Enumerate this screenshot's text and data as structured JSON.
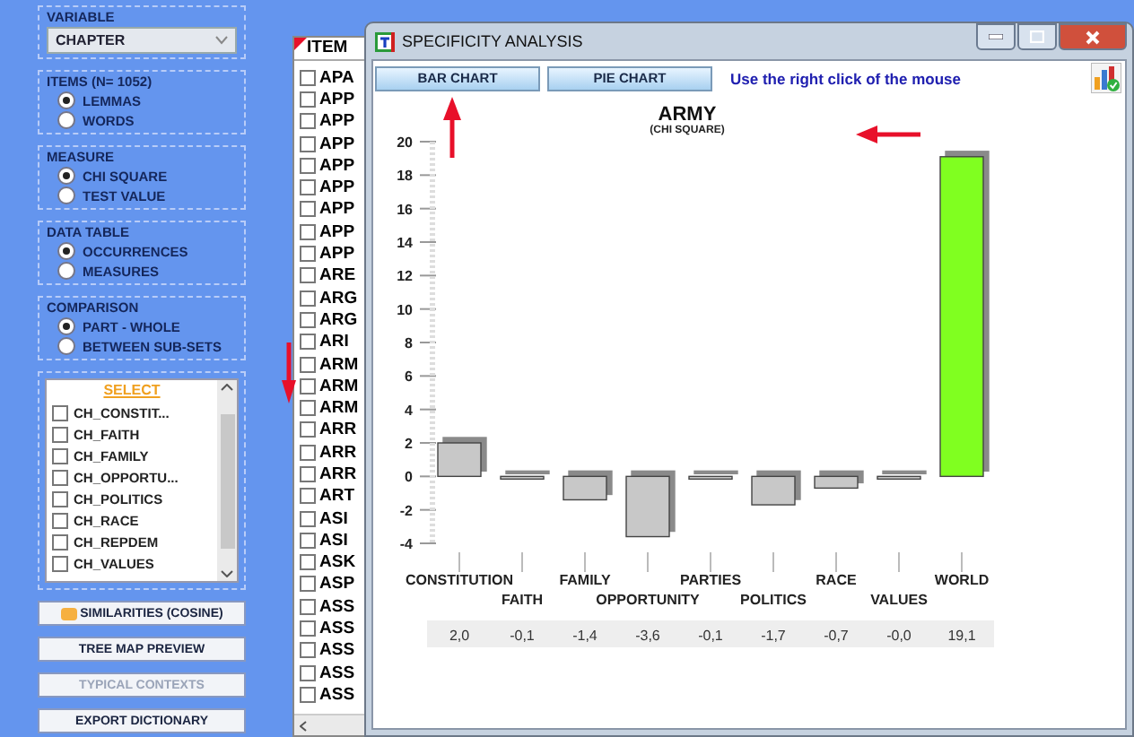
{
  "left_panel": {
    "variable": {
      "label": "VARIABLE",
      "value": "CHAPTER"
    },
    "groups": [
      {
        "title": "ITEMS (N= 1052)",
        "options": [
          {
            "label": "LEMMAS",
            "selected": true
          },
          {
            "label": "WORDS",
            "selected": false
          }
        ]
      },
      {
        "title": "MEASURE",
        "options": [
          {
            "label": "CHI SQUARE",
            "selected": true
          },
          {
            "label": "TEST VALUE",
            "selected": false
          }
        ]
      },
      {
        "title": "DATA TABLE",
        "options": [
          {
            "label": "OCCURRENCES",
            "selected": true
          },
          {
            "label": "MEASURES",
            "selected": false
          }
        ]
      },
      {
        "title": "COMPARISON",
        "options": [
          {
            "label": "PART - WHOLE",
            "selected": true
          },
          {
            "label": "BETWEEN SUB-SETS",
            "selected": false
          }
        ]
      }
    ],
    "select_list": {
      "header": "SELECT",
      "items": [
        {
          "label": "CH_CONSTIT...",
          "checked": false
        },
        {
          "label": "CH_FAITH",
          "checked": false
        },
        {
          "label": "CH_FAMILY",
          "checked": false
        },
        {
          "label": "CH_OPPORTU...",
          "checked": false
        },
        {
          "label": "CH_POLITICS",
          "checked": false
        },
        {
          "label": "CH_RACE",
          "checked": false
        },
        {
          "label": "CH_REPDEM",
          "checked": false
        },
        {
          "label": "CH_VALUES",
          "checked": false
        }
      ]
    },
    "buttons": [
      {
        "label": "SIMILARITIES (COSINE)",
        "kind": "icon",
        "disabled": false
      },
      {
        "label": "TREE MAP PREVIEW",
        "kind": "plain",
        "disabled": false
      },
      {
        "label": "TYPICAL CONTEXTS",
        "kind": "plain",
        "disabled": true
      },
      {
        "label": "EXPORT DICTIONARY",
        "kind": "plain",
        "disabled": false
      }
    ]
  },
  "item_list": {
    "header": "ITEM",
    "rows": [
      {
        "label": "APA",
        "checked": false
      },
      {
        "label": "APP",
        "checked": false
      },
      {
        "label": "APP",
        "checked": false
      },
      {
        "label": "APP",
        "checked": false
      },
      {
        "label": "APP",
        "checked": false
      },
      {
        "label": "APP",
        "checked": false
      },
      {
        "label": "APP",
        "checked": false
      },
      {
        "label": "APP",
        "checked": false
      },
      {
        "label": "APP",
        "checked": false
      },
      {
        "label": "ARE",
        "checked": false
      },
      {
        "label": "ARG",
        "checked": false
      },
      {
        "label": "ARG",
        "checked": false
      },
      {
        "label": "ARI",
        "checked": false
      },
      {
        "label": "ARM",
        "checked": false
      },
      {
        "label": "ARM",
        "checked": false
      },
      {
        "label": "ARM",
        "checked": false,
        "pointer_arrow": true
      },
      {
        "label": "ARR",
        "checked": false
      },
      {
        "label": "ARR",
        "checked": false
      },
      {
        "label": "ARR",
        "checked": false
      },
      {
        "label": "ART",
        "checked": false
      },
      {
        "label": "ASI",
        "checked": false
      },
      {
        "label": "ASI",
        "checked": false
      },
      {
        "label": "ASK",
        "checked": false
      },
      {
        "label": "ASP",
        "checked": false
      },
      {
        "label": "ASS",
        "checked": false
      },
      {
        "label": "ASS",
        "checked": false
      },
      {
        "label": "ASS",
        "checked": false
      },
      {
        "label": "ASS",
        "checked": false
      },
      {
        "label": "ASS",
        "checked": false
      }
    ]
  },
  "window": {
    "title": "SPECIFICITY ANALYSIS",
    "buttons": [
      {
        "label": "BAR CHART",
        "pointer_arrow": true
      },
      {
        "label": "PIE CHART",
        "pointer_arrow": false
      }
    ],
    "hint": "Use the right click of the mouse",
    "chart_subtitle": {
      "text": "(CHI SQUARE)",
      "pointer_arrow": true
    },
    "chart_data": {
      "type": "bar",
      "title": "ARMY",
      "stacked": true,
      "categories": [
        "CONSTITUTION",
        "FAITH",
        "FAMILY",
        "OPPORTUNITY",
        "PARTIES",
        "POLITICS",
        "RACE",
        "VALUES",
        "WORLD"
      ],
      "series": [
        {
          "color": "#c8c8c8",
          "values": [
            2.0,
            -0.1,
            -1.4,
            -3.6,
            -0.1,
            -1.7,
            -0.7,
            -0.0,
            null
          ]
        },
        {
          "color": "#80ff20",
          "values": [
            null,
            null,
            null,
            null,
            null,
            null,
            null,
            null,
            19.1
          ]
        }
      ],
      "ylim": [
        -4,
        20
      ],
      "yticks": [
        -4,
        -2,
        0,
        2,
        4,
        6,
        8,
        10,
        12,
        14,
        16,
        18,
        20
      ],
      "value_labels": [
        "2,0",
        "-0,1",
        "-1,4",
        "-3,6",
        "-0,1",
        "-1,7",
        "-0,7",
        "-0,0",
        "19,1"
      ]
    }
  }
}
